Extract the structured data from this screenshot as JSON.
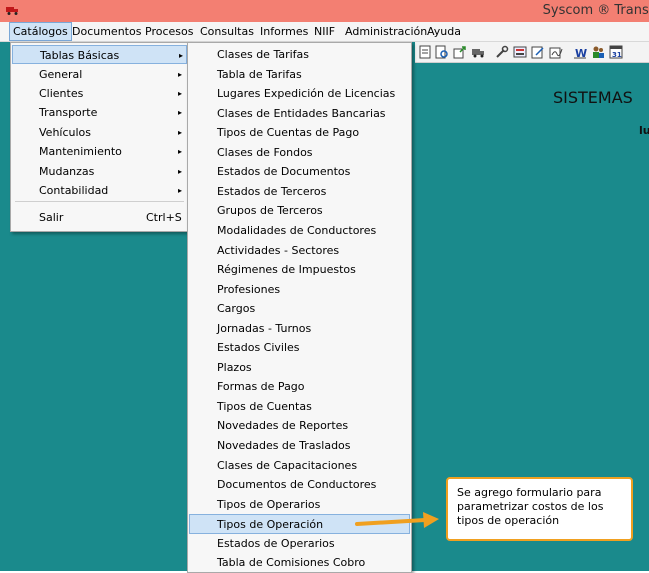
{
  "window": {
    "title": "Syscom ® Transp"
  },
  "menubar": [
    "Catálogos",
    "Documentos",
    "Procesos",
    "Consultas",
    "Informes",
    "NIIF",
    "Administración",
    "Ayuda"
  ],
  "catalogos_menu": {
    "items": [
      {
        "label": "Tablas Básicas",
        "arrow": "▸"
      },
      {
        "label": "General",
        "arrow": "▸"
      },
      {
        "label": "Clientes",
        "arrow": "▸"
      },
      {
        "label": "Transporte",
        "arrow": "▸"
      },
      {
        "label": "Vehículos",
        "arrow": "▸"
      },
      {
        "label": "Mantenimiento",
        "arrow": "▸"
      },
      {
        "label": "Mudanzas",
        "arrow": "▸"
      },
      {
        "label": "Contabilidad",
        "arrow": "▸"
      }
    ],
    "exit": {
      "label": "Salir",
      "shortcut": "Ctrl+S"
    }
  },
  "tablas_basicas_menu": {
    "items": [
      "Clases de Tarifas",
      "Tabla de Tarifas",
      "Lugares Expedición de Licencias",
      "Clases de Entidades Bancarias",
      "Tipos de Cuentas de Pago",
      "Clases de Fondos",
      "Estados de Documentos",
      "Estados de Terceros",
      "Grupos de Terceros",
      "Modalidades de Conductores",
      "Actividades - Sectores",
      "Régimenes de Impuestos",
      "Profesiones",
      "Cargos",
      "Jornadas - Turnos",
      "Estados Civiles",
      "Plazos",
      "Formas de Pago",
      "Tipos de Cuentas",
      "Novedades de Reportes",
      "Novedades de Traslados",
      "Clases de Capacitaciones",
      "Documentos de Conductores",
      "Tipos de Operarios",
      "Tipos de Operación",
      "Estados de Operarios",
      "Tabla de Comisiones Cobro"
    ],
    "highlighted": "Tipos de Operación"
  },
  "workspace": {
    "title_fragment": "SISTEMAS",
    "bold_fragment": "lu"
  },
  "callout": {
    "text": "Se agrego formulario para parametrizar costos de los tipos de operación"
  },
  "colors": {
    "titlebar": "#f37f72",
    "workspace": "#1a8a8c",
    "highlight": "#cfe3f6",
    "callout_border": "#f0a020"
  }
}
